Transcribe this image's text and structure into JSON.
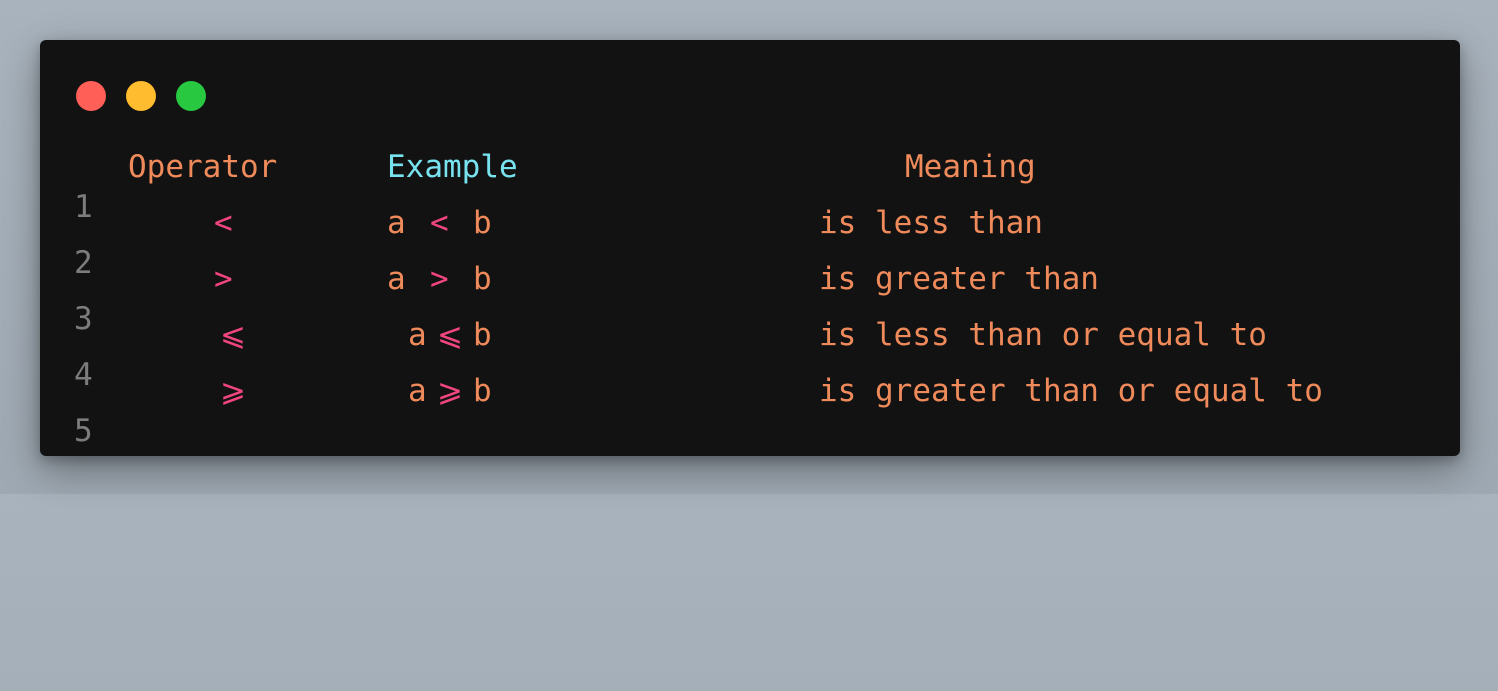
{
  "window_controls": {
    "close_color": "#ff5f57",
    "minimize_color": "#febc2e",
    "maximize_color": "#28c840"
  },
  "colors": {
    "line_number": "#7c7c7c",
    "text": "#ef8a5b",
    "operator": "#f0457f",
    "highlight": "#78e3ee",
    "background": "#121212"
  },
  "lines": [
    {
      "number": "1",
      "operator": "Operator",
      "example_a": "Example",
      "example_op": "",
      "example_b": "",
      "meaning": "Meaning"
    },
    {
      "number": "2",
      "operator": "<",
      "example_a": "a",
      "example_op": "<",
      "example_b": "b",
      "meaning": "is less than"
    },
    {
      "number": "3",
      "operator": ">",
      "example_a": "a",
      "example_op": ">",
      "example_b": "b",
      "meaning": "is greater than"
    },
    {
      "number": "4",
      "operator": "⩽",
      "example_a": "a",
      "example_op": "⩽",
      "example_b": "b",
      "meaning": "is less than or equal to"
    },
    {
      "number": "5",
      "operator": "⩾",
      "example_a": "a",
      "example_op": "⩾",
      "example_b": "b",
      "meaning": "is greater than or equal to"
    }
  ]
}
